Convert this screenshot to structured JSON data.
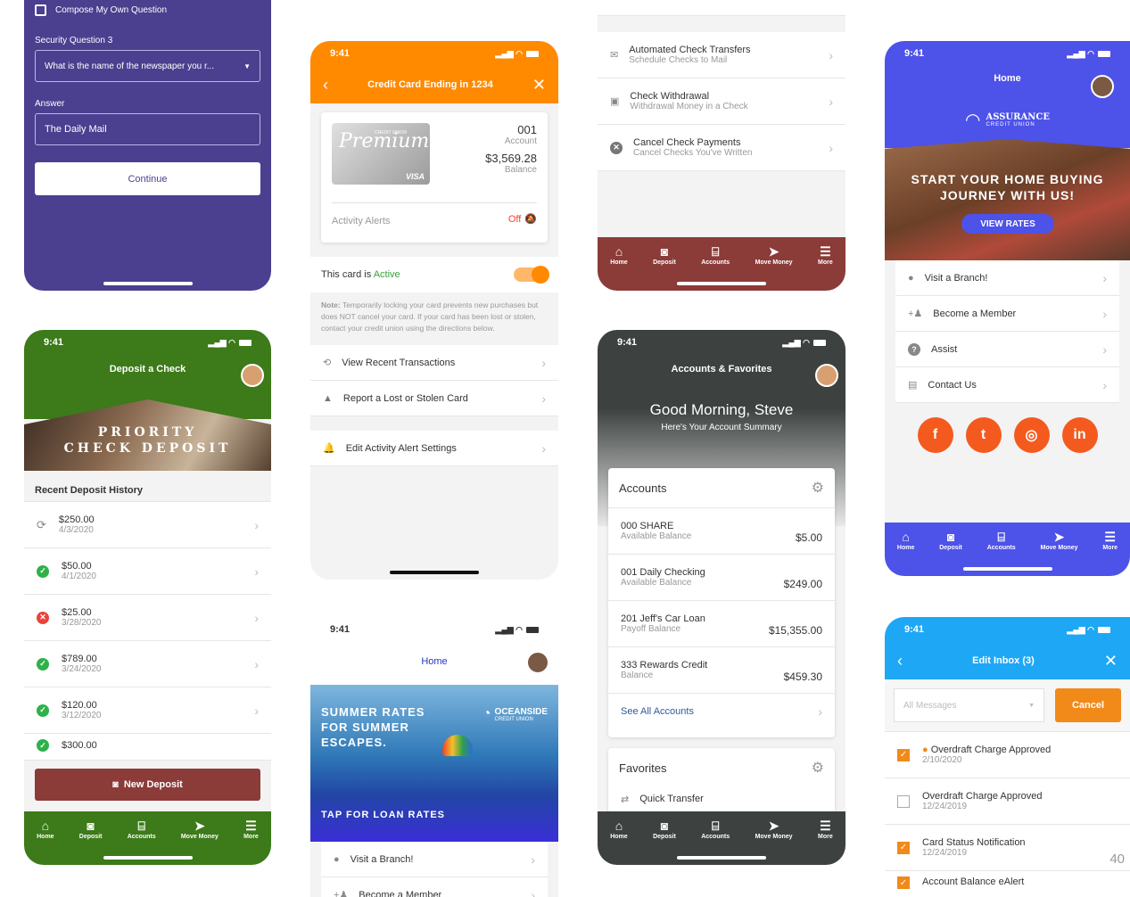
{
  "colors": {
    "purple": "#4b3f8f",
    "orange": "#ff8a00",
    "green": "#3c7a1a",
    "maroon": "#8b3b38",
    "gray": "#3d4240",
    "blue": "#4d52e8",
    "cyan": "#1ea7f5"
  },
  "p1": {
    "compose": "Compose My Own Question",
    "sq_label": "Security Question 3",
    "sq_value": "What is the name of the newspaper you r...",
    "answer_label": "Answer",
    "answer_value": "The Daily Mail",
    "continue": "Continue"
  },
  "p2": {
    "time": "9:41",
    "title": "Credit Card Ending in 1234",
    "card_brand": "Premium",
    "card_union": "CREDIT UNION",
    "card_visa": "VISA",
    "acct": "001",
    "acct_label": "Account",
    "balance": "$3,569.28",
    "balance_label": "Balance",
    "alerts": "Activity Alerts",
    "alerts_state": "Off",
    "card_is": "This card is",
    "card_status": "Active",
    "note_bold": "Note:",
    "note": "Temporarily locking your card prevents new purchases but does NOT cancel your card. If your card has been lost or stolen, contact your credit union using the directions below.",
    "items": [
      "View Recent Transactions",
      "Report a Lost or Stolen Card"
    ],
    "edit": "Edit Activity Alert Settings"
  },
  "p3": {
    "items": [
      {
        "t": "Automated Check Transfers",
        "s": "Schedule Checks to Mail"
      },
      {
        "t": "Check Withdrawal",
        "s": "Withdrawal Money in a Check"
      },
      {
        "t": "Cancel Check Payments",
        "s": "Cancel Checks You've Written"
      }
    ],
    "nav": [
      "Home",
      "Deposit",
      "Accounts",
      "Move Money",
      "More"
    ]
  },
  "p4": {
    "time": "9:41",
    "title": "Home",
    "brand": "ASSURANCE",
    "brand_sub": "CREDIT UNION",
    "hero": "START YOUR HOME BUYING JOURNEY WITH US!",
    "cta": "VIEW RATES",
    "items": [
      "Visit a Branch!",
      "Become a Member",
      "Assist",
      "Contact Us"
    ],
    "nav": [
      "Home",
      "Deposit",
      "Accounts",
      "Move Money",
      "More"
    ]
  },
  "p5": {
    "time": "9:41",
    "title": "Deposit a Check",
    "hero": "PRIORITY CHECK DEPOSIT",
    "history": "Recent Deposit History",
    "deposits": [
      {
        "a": "$250.00",
        "d": "4/3/2020",
        "s": "pending"
      },
      {
        "a": "$50.00",
        "d": "4/1/2020",
        "s": "ok"
      },
      {
        "a": "$25.00",
        "d": "3/28/2020",
        "s": "fail"
      },
      {
        "a": "$789.00",
        "d": "3/24/2020",
        "s": "ok"
      },
      {
        "a": "$120.00",
        "d": "3/12/2020",
        "s": "ok"
      },
      {
        "a": "$300.00",
        "d": "",
        "s": "ok"
      }
    ],
    "new": "New Deposit",
    "nav": [
      "Home",
      "Deposit",
      "Accounts",
      "Move Money",
      "More"
    ]
  },
  "p6": {
    "time": "9:41",
    "title": "Accounts & Favorites",
    "greeting": "Good Morning, Steve",
    "summary": "Here's Your Account Summary",
    "accounts_h": "Accounts",
    "accounts": [
      {
        "n": "000 SHARE",
        "l": "Available Balance",
        "v": "$5.00"
      },
      {
        "n": "001 Daily Checking",
        "l": "Available Balance",
        "v": "$249.00"
      },
      {
        "n": "201 Jeff's Car Loan",
        "l": "Payoff Balance",
        "v": "$15,355.00"
      },
      {
        "n": "333 Rewards Credit",
        "l": "Balance",
        "v": "$459.30"
      }
    ],
    "see_all": "See All Accounts",
    "fav_h": "Favorites",
    "fav": "Quick Transfer",
    "nav": [
      "Home",
      "Deposit",
      "Accounts",
      "Move Money",
      "More"
    ]
  },
  "p7": {
    "time": "9:41",
    "title": "Home",
    "hero1": "SUMMER RATES",
    "hero2": "FOR SUMMER",
    "hero3": "ESCAPES.",
    "brand": "OCEANSIDE",
    "brand_sub": "CREDIT UNION",
    "tap": "TAP FOR LOAN RATES",
    "items": [
      "Visit a Branch!",
      "Become a Member"
    ]
  },
  "p8": {
    "time": "9:41",
    "title": "Edit Inbox (3)",
    "filter": "All Messages",
    "cancel": "Cancel",
    "msgs": [
      {
        "t": "Overdraft Charge Approved",
        "d": "2/10/2020",
        "c": true,
        "dot": true
      },
      {
        "t": "Overdraft Charge Approved",
        "d": "12/24/2019",
        "c": false,
        "dot": false
      },
      {
        "t": "Card Status Notification",
        "d": "12/24/2019",
        "c": true,
        "dot": false
      },
      {
        "t": "Account Balance eAlert",
        "d": "",
        "c": true,
        "dot": false
      }
    ],
    "count": "40"
  }
}
